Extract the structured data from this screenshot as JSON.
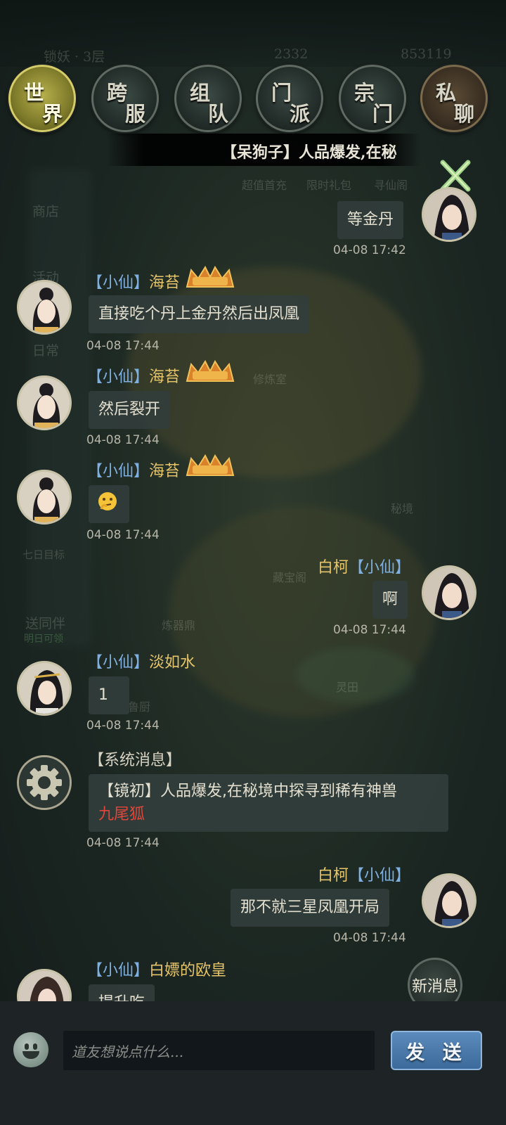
{
  "background": {
    "top_stats": [
      "锁妖 · 3层",
      "2332",
      "853119"
    ],
    "sidebar": [
      "商店",
      "活动",
      "日常",
      "七日目标",
      "送同伴",
      "明日可领"
    ],
    "map_labels": [
      "超值首充",
      "限时礼包",
      "寻仙阁",
      "修炼室",
      "秘境",
      "藏宝阁",
      "炼器鼎",
      "灵田",
      "鲁厨"
    ]
  },
  "tabs": [
    {
      "c1": "世",
      "c2": "界",
      "state": "active"
    },
    {
      "c1": "跨",
      "c2": "服",
      "state": "normal"
    },
    {
      "c1": "组",
      "c2": "队",
      "state": "normal"
    },
    {
      "c1": "门",
      "c2": "派",
      "state": "normal"
    },
    {
      "c1": "宗",
      "c2": "门",
      "state": "normal"
    },
    {
      "c1": "私",
      "c2": "聊",
      "state": "private"
    }
  ],
  "marquee": "【呆狗子】人品爆发,在秘",
  "messages": [
    {
      "side": "right",
      "text": "等金丹",
      "time": "04-08 17:42"
    },
    {
      "side": "left",
      "tag": "【小仙】",
      "name": "海苔",
      "text": "直接吃个丹上金丹然后出凤凰",
      "time": "04-08 17:44"
    },
    {
      "side": "left",
      "tag": "【小仙】",
      "name": "海苔",
      "text": "然后裂开",
      "time": "04-08 17:44"
    },
    {
      "side": "left",
      "tag": "【小仙】",
      "name": "海苔",
      "text": "🤔",
      "time": "04-08 17:44"
    },
    {
      "side": "right",
      "name": "白柯",
      "tag": "【小仙】",
      "text": "啊",
      "time": "04-08 17:44"
    },
    {
      "side": "left",
      "tag": "【小仙】",
      "name": "淡如水",
      "text": "1",
      "time": "04-08 17:44"
    },
    {
      "side": "right",
      "name": "白柯",
      "tag": "【小仙】",
      "text": "那不就三星凤凰开局",
      "time": "04-08 17:44"
    },
    {
      "side": "left",
      "tag": "【小仙】",
      "name": "白嫖的欧皇",
      "text": "提升吃",
      "time": ""
    }
  ],
  "system": {
    "title": "【系统消息】",
    "text": "【镜初】人品爆发,在秘境中探寻到稀有神兽",
    "highlight": "九尾狐",
    "time": "04-08 17:44"
  },
  "new_message": "新消息",
  "input": {
    "placeholder": "道友想说点什么..."
  },
  "send_label": "发 送",
  "colors": {
    "tag_blue": "#7fb0e0",
    "name_gold": "#e6c46a",
    "highlight_red": "#e0473a",
    "send_blue": "#4a7aab"
  }
}
